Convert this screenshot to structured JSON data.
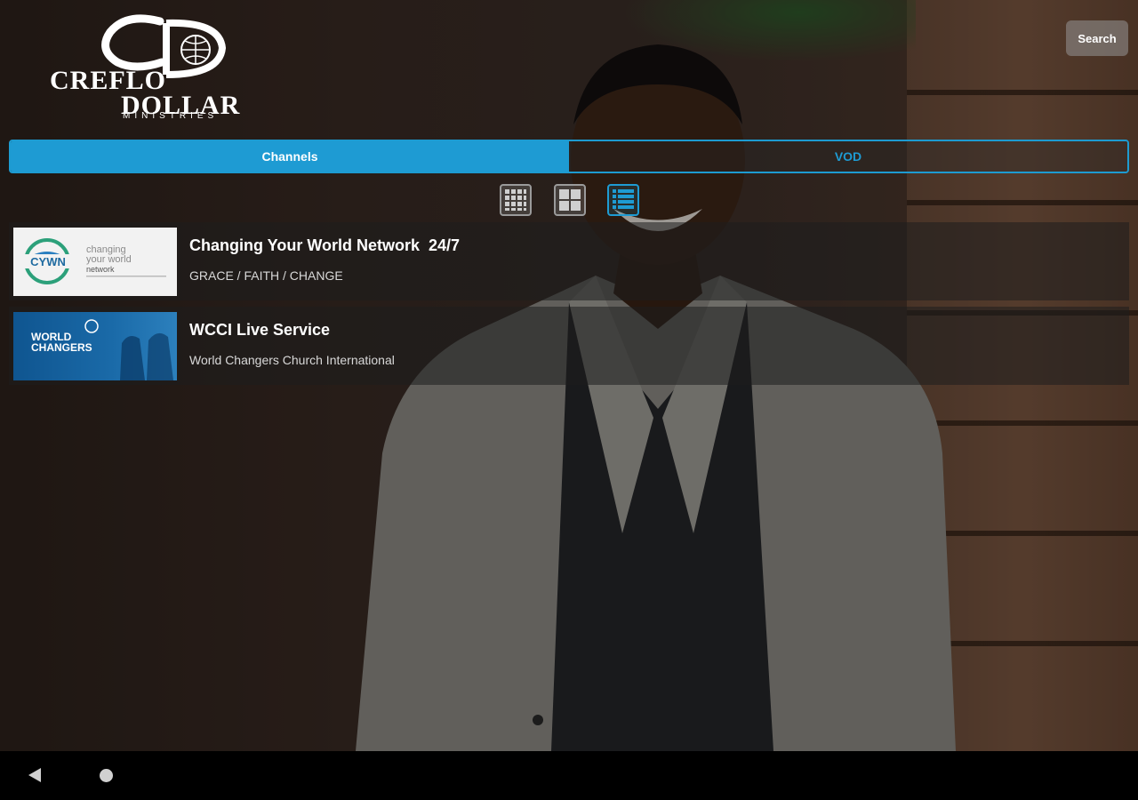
{
  "app": {
    "logo": {
      "line1": "CREFLO",
      "line2": "DOLLAR",
      "line3": "MINISTRIES",
      "monogram": "CD"
    },
    "search_label": "Search"
  },
  "tabs": [
    {
      "label": "Channels",
      "active": true
    },
    {
      "label": "VOD",
      "active": false
    }
  ],
  "view_modes": [
    {
      "icon": "grid-small-icon",
      "active": false
    },
    {
      "icon": "grid-large-icon",
      "active": false
    },
    {
      "icon": "list-view-icon",
      "active": true
    }
  ],
  "channels": [
    {
      "title": "Changing Your World Network  24/7",
      "subtitle": "GRACE / FAITH / CHANGE",
      "thumb": {
        "badge": "CYWN",
        "lines": [
          "changing",
          "your world",
          "network"
        ]
      }
    },
    {
      "title": "WCCI Live Service",
      "subtitle": "World Changers Church International",
      "thumb": {
        "lines": [
          "WORLD",
          "CHANGERS"
        ]
      }
    }
  ],
  "colors": {
    "accent": "#1e9bd3",
    "row_bg": "#1e1e1e",
    "navbar": "#000000"
  }
}
